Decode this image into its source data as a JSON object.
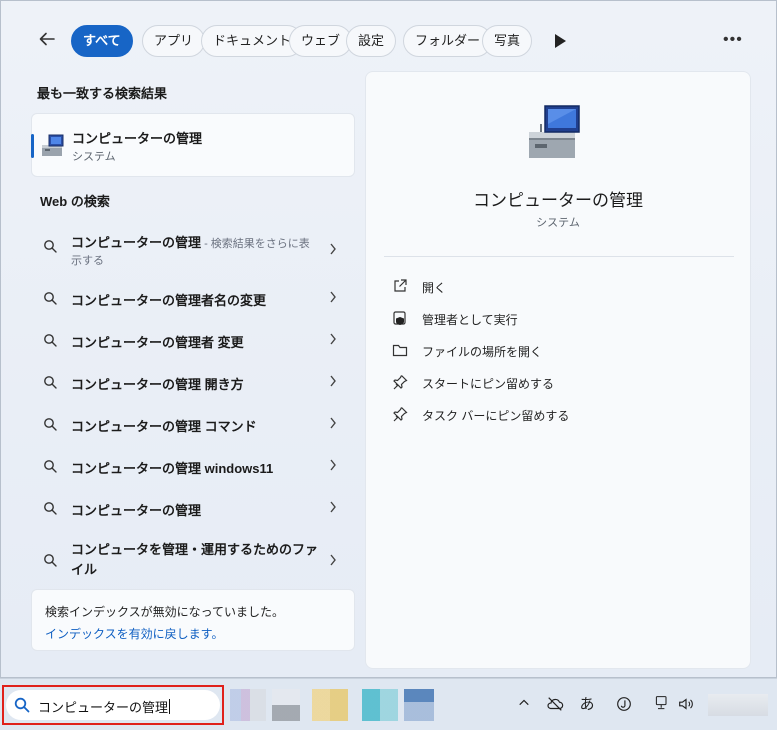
{
  "filters": {
    "items": [
      "すべて",
      "アプリ",
      "ドキュメント",
      "ウェブ",
      "設定",
      "フォルダー",
      "写真"
    ],
    "active_index": 0,
    "more_label": "•••"
  },
  "best_match": {
    "heading": "最も一致する検索結果",
    "title": "コンピューターの管理",
    "subtitle": "システム"
  },
  "web_search": {
    "heading": "Web の検索",
    "items": [
      {
        "bold": "コンピューターの管理",
        "rest": " - 検索結果をさらに表",
        "line2": "示する"
      },
      {
        "bold": "コンピューターの管理者名の変更"
      },
      {
        "bold": "コンピューターの管理者 変更"
      },
      {
        "bold": "コンピューターの管理 開き方"
      },
      {
        "bold": "コンピューターの管理 コマンド"
      },
      {
        "bold": "コンピューターの管理 windows11"
      },
      {
        "bold": "コンピューターの管理"
      },
      {
        "bold": "コンピュータを管理・運用するためのファ",
        "line2": "イル"
      }
    ]
  },
  "notice": {
    "line1": "検索インデックスが無効になっていました。",
    "link": "インデックスを有効に戻します。"
  },
  "preview": {
    "title": "コンピューターの管理",
    "subtitle": "システム",
    "actions": [
      "開く",
      "管理者として実行",
      "ファイルの場所を開く",
      "スタートにピン留めする",
      "タスク バーにピン留めする"
    ]
  },
  "taskbar": {
    "search_value": "コンピューターの管理",
    "tray": {
      "ime": "あ"
    }
  },
  "colors": {
    "accent": "#1765c6",
    "highlight_border": "#e0211b",
    "link": "#0f5fc2"
  }
}
